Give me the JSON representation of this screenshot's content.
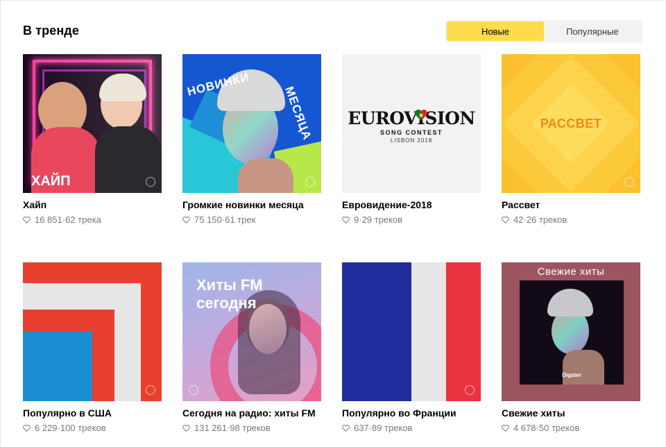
{
  "section": {
    "title": "В тренде"
  },
  "tabs": [
    {
      "label": "Новые",
      "active": true
    },
    {
      "label": "Популярные",
      "active": false
    }
  ],
  "playlists": [
    {
      "title": "Хайп",
      "likes": "16 851",
      "tracks": "62 трека",
      "cover_text": "ХАЙП"
    },
    {
      "title": "Громкие новинки месяца",
      "likes": "75 150",
      "tracks": "61 трек",
      "cover_text_1": "НОВИНКИ",
      "cover_text_2": "МЕСЯЦА"
    },
    {
      "title": "Евровидение-2018",
      "likes": "9",
      "tracks": "29 треков",
      "cover_text_1": "EUROVISION",
      "cover_text_2": "SONG CONTEST",
      "cover_text_3": "LISBON 2018"
    },
    {
      "title": "Рассвет",
      "likes": "42",
      "tracks": "26 треков",
      "cover_text": "РАССВЕТ"
    },
    {
      "title": "Популярно в США",
      "likes": "6 229",
      "tracks": "100 треков"
    },
    {
      "title": "Сегодня на радио: хиты FM",
      "likes": "131 261",
      "tracks": "98 треков",
      "cover_text_1": "Хиты FM",
      "cover_text_2": "сегодня"
    },
    {
      "title": "Популярно во Франции",
      "likes": "637",
      "tracks": "89 треков"
    },
    {
      "title": "Свежие хиты",
      "likes": "4 678",
      "tracks": "50 треков",
      "cover_text": "Свежие хиты",
      "badge_text": "Digster"
    }
  ],
  "meta_separator": " · ",
  "colors": {
    "accent_tab": "#ffdb4d",
    "title_text": "#000000",
    "meta_text": "#777777"
  }
}
